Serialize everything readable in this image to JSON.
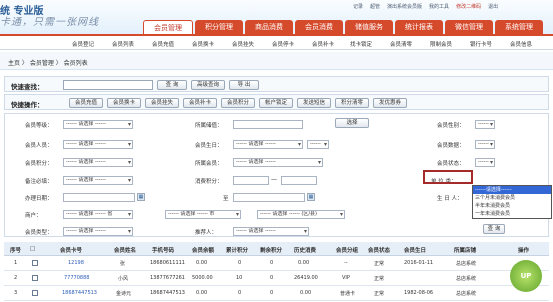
{
  "app": {
    "logo": "统 专业版",
    "slogan": "卡通，只需一张网线",
    "top_links": [
      "记录",
      "超管",
      "演出系统会员版",
      "我的工具",
      "退出"
    ],
    "top_highlight": "修改二维码"
  },
  "nav": {
    "tabs": [
      "会员管理",
      "积分管理",
      "商品消费",
      "会员消费",
      "储值服务",
      "统计报表",
      "微信管理",
      "系统管理"
    ],
    "active": 0
  },
  "subnav": [
    "会员登记",
    "会员列表",
    "会员充值",
    "会员换卡",
    "会员挂失",
    "会员停卡",
    "会员补卡",
    "找卡锁定",
    "会员清零",
    "限制会员",
    "银行卡号",
    "会员信息"
  ],
  "crumb": "主页 〉 会员管理 〉 会员列表",
  "quick_search": {
    "label": "快速查找：",
    "placeholder": "",
    "buttons": [
      "查 询",
      "高级查询",
      "导 出"
    ]
  },
  "quick_ops": {
    "label": "快捷操作：",
    "buttons": [
      "会员充值",
      "会员换卡",
      "会员挂失",
      "会员补卡",
      "会员积分",
      "帐户锁定",
      "发送短信",
      "积分清零",
      "发优惠券"
    ]
  },
  "form": {
    "labels": [
      "会员等级：",
      "会员人员：",
      "会员积分：",
      "备注必填：",
      "会员生日：",
      "所属储值：",
      "所属会员：",
      "消费积分：",
      "员工部门：",
      "出生日期：",
      "办理日期：",
      "商户：",
      "会员余额：",
      "会员类型：",
      "推荐人：",
      "会员性别：",
      "会员数据：",
      "会员状态：",
      "单 位 类：",
      "生 日 人：",
      "区/县"
    ],
    "select_default": "------ 请选择 ------",
    "select_short": "------",
    "province": "------ 请选择 ------ 省",
    "city": "------ 请选择 ------ 市",
    "county": "------ 请选择 ------ (区/县)",
    "select_btn": "选择",
    "confirm_btn": "查 询"
  },
  "dropdown": {
    "options": [
      "------请选择------",
      "三个月未消费会员",
      "半年未消费会员",
      "一年未消费会员"
    ],
    "selected": 0
  },
  "table": {
    "headers": [
      "序号",
      "□",
      "会员卡号",
      "会员姓名",
      "手机号码",
      "会员余额",
      "累计积分",
      "剩余积分",
      "历史消费",
      "会员分组",
      "会员状态",
      "会员生日",
      "所属店铺",
      "操作"
    ],
    "rows": [
      {
        "no": "1",
        "card": "12198",
        "name": "张",
        "phone": "18680611111",
        "balance": "0.00",
        "total": "0",
        "left": "0",
        "hist": "0.00",
        "group": "--",
        "status": "正常",
        "birthday": "2016-01-11",
        "shop": "总店系统",
        "op": "修改"
      },
      {
        "no": "2",
        "card": "77770888",
        "name": "小风",
        "phone": "13877677261",
        "balance": "5000.00",
        "total": "10",
        "left": "0",
        "hist": "26419.00",
        "group": "VIP",
        "status": "正常",
        "birthday": "",
        "shop": "总店系统",
        "op": "修改"
      },
      {
        "no": "3",
        "card": "18687447513",
        "name": "金诗元",
        "phone": "18687447513",
        "balance": "0.00",
        "total": "0",
        "left": "0",
        "hist": "0.00",
        "group": "普通卡",
        "status": "正常",
        "birthday": "1982-08-06",
        "shop": "总店系统",
        "op": "修改"
      }
    ]
  },
  "badge": {
    "label": "UP"
  }
}
